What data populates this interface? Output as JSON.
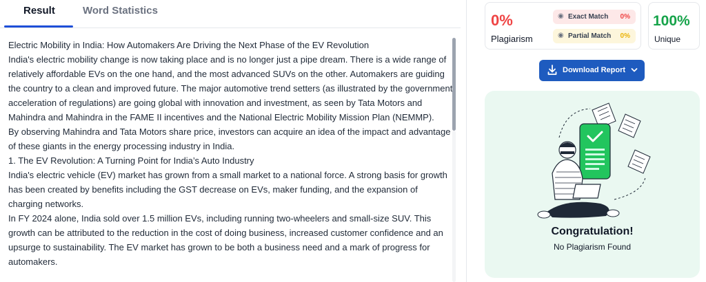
{
  "tabs": {
    "result": "Result",
    "word_statistics": "Word Statistics"
  },
  "content": {
    "paragraphs": [
      "Electric Mobility in India: How Automakers Are Driving the Next Phase of the EV Revolution",
      "India's electric mobility change is now taking place and is no longer just a pipe dream. There is a wide range of relatively affordable EVs on the one hand, and the most advanced SUVs on the other. Automakers are guiding the country to a clean and improved future. The major automotive trend setters (as illustrated by the government acceleration of regulations) are going global with innovation and investment, as seen by Tata Motors and Mahindra and Mahindra in the FAME II incentives and the National Electric Mobility Mission Plan (NEMMP).",
      "By observing Mahindra and Tata Motors share price, investors can acquire an idea of the impact and advantage of these giants in the energy processing industry in India.",
      "1. The EV Revolution: A Turning Point for India’s Auto Industry",
      "India's electric vehicle (EV) market has grown from a small market to a national force. A strong basis for growth has been created by benefits including the GST decrease on EVs, maker funding, and the expansion of charging networks.",
      "In FY 2024 alone, India sold over 1.5 million EVs, including running two-wheelers and small-size SUV. This growth can be attributed to the reduction in the cost of doing business, increased customer confidence and an upsurge to sustainability. The EV market has grown to be both a business need and a mark of progress for automakers."
    ]
  },
  "stats": {
    "plagiarism_pct": "0%",
    "plagiarism_label": "Plagiarism",
    "exact_match_label": "Exact Match",
    "exact_match_pct": "0%",
    "partial_match_label": "Partial Match",
    "partial_match_pct": "0%",
    "unique_pct": "100%",
    "unique_label": "Unique"
  },
  "download": {
    "label": "Download Report"
  },
  "result": {
    "title": "Congratulation!",
    "subtitle": "No Plagiarism Found"
  },
  "colors": {
    "accent": "#1e5bbf",
    "danger": "#ef4444",
    "warning": "#eab308",
    "success": "#16a34a",
    "result_bg": "#eaf8f1"
  }
}
